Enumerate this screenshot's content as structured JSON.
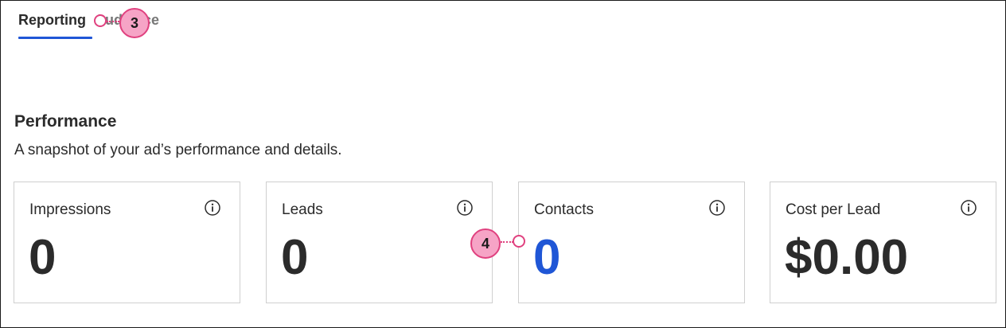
{
  "tabs": [
    {
      "label": "Reporting",
      "active": true
    },
    {
      "label": "Audience",
      "active": false
    }
  ],
  "performance": {
    "title": "Performance",
    "description": "A snapshot of your ad’s performance and details."
  },
  "cards": [
    {
      "label": "Impressions",
      "value": "0"
    },
    {
      "label": "Leads",
      "value": "0"
    },
    {
      "label": "Contacts",
      "value": "0"
    },
    {
      "label": "Cost per Lead",
      "value": "$0.00"
    }
  ],
  "callouts": [
    {
      "number": "3"
    },
    {
      "number": "4"
    }
  ],
  "colors": {
    "accent": "#1f56d6",
    "callout_fill": "#f6a4c6",
    "callout_border": "#e0417f"
  }
}
